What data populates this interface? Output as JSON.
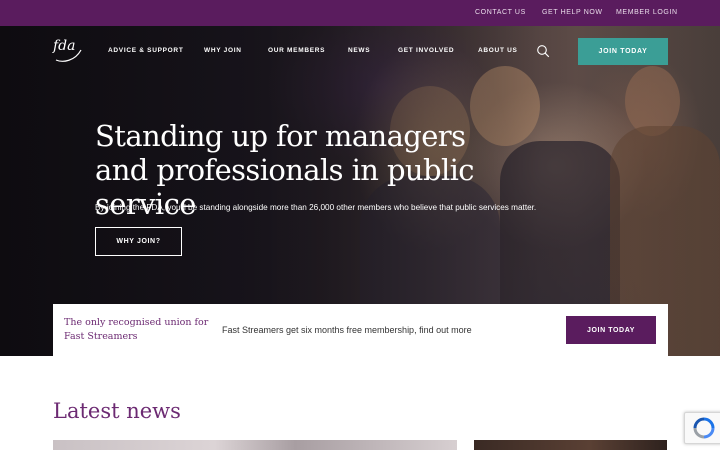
{
  "utility_nav": {
    "contact": "CONTACT US",
    "help": "GET HELP NOW",
    "login": "MEMBER LOGIN"
  },
  "logo": {
    "text": "fda"
  },
  "main_nav": {
    "items": [
      "ADVICE & SUPPORT",
      "WHY JOIN",
      "OUR MEMBERS",
      "NEWS",
      "GET INVOLVED",
      "ABOUT US"
    ],
    "search_icon": "search-icon",
    "join_label": "JOIN TODAY"
  },
  "hero": {
    "title": "Standing up for managers and professionals in public service",
    "subtitle": "By joining the FDA, you'll be standing alongside more than 26,000 other members who believe that public services matter.",
    "cta_label": "WHY JOIN?"
  },
  "promo": {
    "title": "The only recognised union for Fast Streamers",
    "text": "Fast Streamers get six months free membership, find out more",
    "button_label": "JOIN TODAY"
  },
  "news": {
    "heading": "Latest news"
  },
  "colors": {
    "brand_purple": "#5a1c5e",
    "heading_purple": "#6c2a72",
    "accent_teal": "#3b9e96"
  },
  "recaptcha": {
    "icon": "recaptcha-icon"
  }
}
